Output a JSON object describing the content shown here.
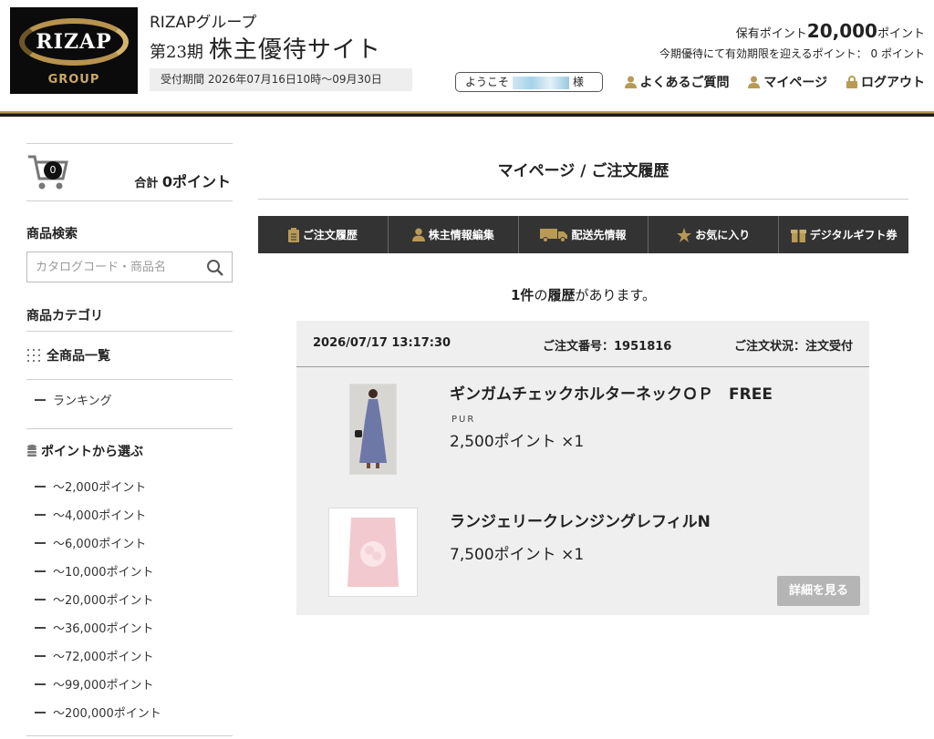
{
  "header": {
    "logo_text": "RIZAP",
    "logo_sub": "GROUP",
    "group_name": "RIZAPグループ",
    "period": "第23期",
    "site_name": "株主優待サイト",
    "reception_label": "受付期間",
    "reception_value": "2026年07月16日10時～09月30日",
    "points_label": "保有ポイント",
    "points_value": "20,000",
    "points_unit": "ポイント",
    "expiring_label": "今期優待にて有効期限を迎えるポイント：",
    "expiring_value": "0",
    "expiring_unit": "ポイント",
    "welcome_prefix": "ようこそ",
    "welcome_suffix": "様",
    "links": [
      "よくあるご質問",
      "マイページ",
      "ログアウト"
    ]
  },
  "sidebar": {
    "cart_count": "0",
    "cart_total_label": "合計",
    "cart_total_value": "0ポイント",
    "search_heading": "商品検索",
    "search_placeholder": "カタログコード・商品名",
    "category_heading": "商品カテゴリ",
    "all_items": "全商品一覧",
    "ranking": "ランキング",
    "points_heading": "ポイントから選ぶ",
    "point_ranges": [
      "～2,000ポイント",
      "～4,000ポイント",
      "～6,000ポイント",
      "～10,000ポイント",
      "～20,000ポイント",
      "～36,000ポイント",
      "～72,000ポイント",
      "～99,000ポイント",
      "～200,000ポイント"
    ]
  },
  "main": {
    "title": "マイページ / ご注文履歴",
    "tabs": [
      "ご注文履歴",
      "株主情報編集",
      "配送先情報",
      "お気に入り",
      "デジタルギフト券"
    ],
    "count_number": "1件",
    "count_of": "の",
    "count_word": "履歴",
    "count_suffix": "があります。",
    "order": {
      "date": "2026/07/17 13:17:30",
      "number_label": "ご注文番号：",
      "number": "1951816",
      "status_label": "ご注文状況：",
      "status": "注文受付",
      "items": [
        {
          "name": "ギンガムチェックホルターネックＯＰ　FREE",
          "brand": "PUR",
          "price": "2,500ポイント ×1"
        },
        {
          "name": "ランジェリークレンジングレフィルN",
          "brand": "",
          "price": "7,500ポイント ×1"
        }
      ],
      "detail_button": "詳細を見る"
    }
  },
  "colors": {
    "gold": "#b89a55",
    "dark_bar": "#333333",
    "order_bg": "#efefef",
    "button_gray": "#b5b5b5"
  }
}
